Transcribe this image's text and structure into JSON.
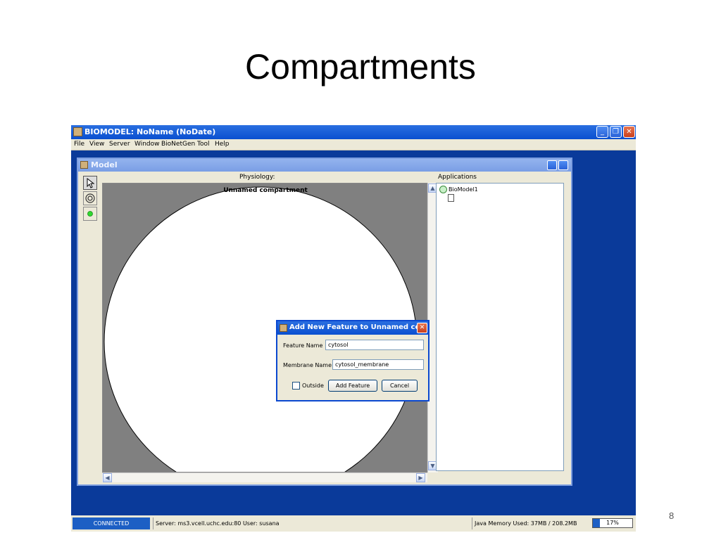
{
  "slide": {
    "title": "Compartments",
    "number": "8"
  },
  "window": {
    "title": "BIOMODEL: NoName (NoDate)"
  },
  "menu": [
    "File",
    "View",
    "Server",
    "Window",
    "BioNetGen",
    "Tool",
    "Help"
  ],
  "model_frame": {
    "title": "Model"
  },
  "physiology": {
    "label": "Physiology:",
    "compartment": "Unnamed compartment"
  },
  "applications": {
    "label": "Applications",
    "root": "BioModel1"
  },
  "dialog": {
    "title": "Add New Feature to Unnamed co...",
    "feature_label": "Feature Name",
    "feature_value": "cytosol",
    "membrane_label": "Membrane Name",
    "membrane_value": "cytosol_membrane",
    "outside_label": "Outside",
    "add_label": "Add Feature",
    "cancel_label": "Cancel"
  },
  "status": {
    "connected": "CONNECTED",
    "server": "Server: ms3.vcell.uchc.edu:80 User: susana",
    "memory": "Java Memory Used: 37MB / 208.2MB",
    "progress_text": "17%",
    "progress_fraction": 0.17
  },
  "colors": {
    "accent": "#0a4fd0",
    "desktop": "#0a3a9a"
  }
}
